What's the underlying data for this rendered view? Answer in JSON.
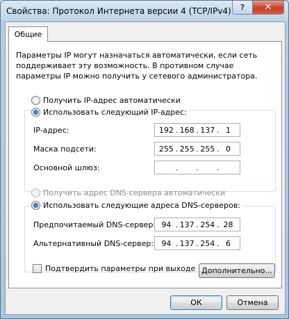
{
  "window": {
    "title": "Свойства: Протокол Интернета версии 4 (TCP/IPv4)",
    "help_glyph": "?",
    "close_glyph": "✕"
  },
  "tabs": [
    {
      "label": "Общие",
      "active": true
    }
  ],
  "description": "Параметры IP могут назначаться автоматически, если сеть поддерживает эту возможность. В противном случае параметры IP можно получить у сетевого администратора.",
  "ip": {
    "auto_label": "Получить IP-адрес автоматически",
    "auto_checked": false,
    "manual_label": "Использовать следующий IP-адрес:",
    "manual_checked": true,
    "fields": [
      {
        "label": "IP-адрес:",
        "octets": [
          "192",
          "168",
          "137",
          "1"
        ]
      },
      {
        "label": "Маска подсети:",
        "octets": [
          "255",
          "255",
          "255",
          "0"
        ]
      },
      {
        "label": "Основной шлюз:",
        "octets": [
          "",
          "",
          "",
          ""
        ]
      }
    ]
  },
  "dns": {
    "auto_label": "Получить адрес DNS-сервера автоматически",
    "auto_enabled": false,
    "manual_label": "Использовать следующие адреса DNS-серверов:",
    "manual_checked": true,
    "fields": [
      {
        "label": "Предпочитаемый DNS-сервер:",
        "octets": [
          "94",
          "137",
          "254",
          "28"
        ]
      },
      {
        "label": "Альтернативный DNS-сервер:",
        "octets": [
          "94",
          "137",
          "254",
          "6"
        ]
      }
    ]
  },
  "validate": {
    "label": "Подтвердить параметры при выходе",
    "checked": false
  },
  "buttons": {
    "advanced": "Дополнительно...",
    "ok": "ОК",
    "cancel": "Отмена"
  }
}
